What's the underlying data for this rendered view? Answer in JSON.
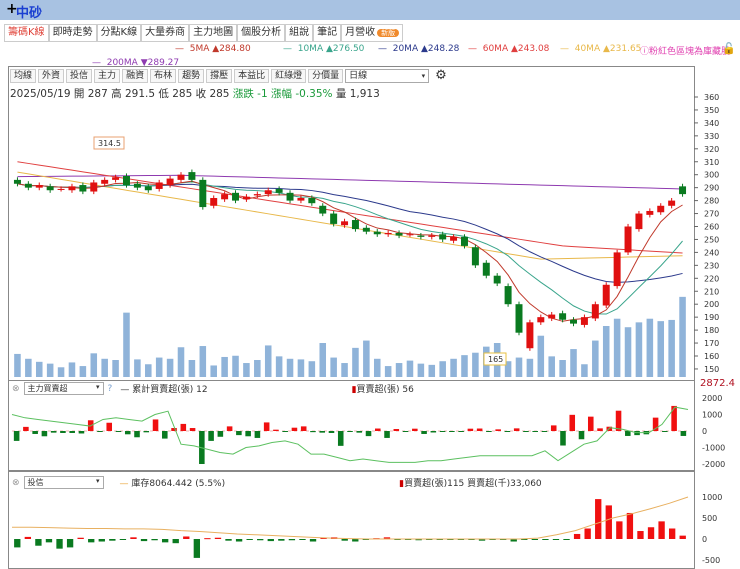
{
  "header": {
    "plus": "+",
    "stock_name": "中砂"
  },
  "tabs": [
    {
      "label": "籌碼K線",
      "active": true
    },
    {
      "label": "即時走勢"
    },
    {
      "label": "分點K線"
    },
    {
      "label": "大量券商"
    },
    {
      "label": "主力地圖"
    },
    {
      "label": "個股分析"
    },
    {
      "label": "組說"
    },
    {
      "label": "筆記"
    },
    {
      "label": "月營收",
      "badge": "新版"
    }
  ],
  "ma_legend": [
    {
      "label": "5MA",
      "arrow": "▲",
      "value": "284.80",
      "color": "#c0392b"
    },
    {
      "label": "10MA",
      "arrow": "▲",
      "value": "276.50",
      "color": "#3aa58c"
    },
    {
      "label": "20MA",
      "arrow": "▲",
      "value": "248.28",
      "color": "#2c3a8c"
    },
    {
      "label": "60MA",
      "arrow": "▲",
      "value": "243.08",
      "color": "#e04040"
    },
    {
      "label": "40MA",
      "arrow": "▲",
      "value": "231.65",
      "color": "#e8b84a"
    },
    {
      "label": "200MA",
      "arrow": "▼",
      "value": "289.27",
      "color": "#8e3ab0"
    }
  ],
  "hint": "ⓘ粉紅色區塊為庫藏股",
  "toolbar": [
    "均線",
    "外資",
    "投信",
    "主力",
    "融資",
    "布林",
    "趨勢",
    "撐壓",
    "本益比",
    "紅綠燈",
    "分價量"
  ],
  "period_select": "日線",
  "info": {
    "date": "2025/05/19",
    "open_label": "開",
    "open": "287",
    "high_label": "高",
    "high": "291.5",
    "low_label": "低",
    "low": "285",
    "close_label": "收",
    "close": "285",
    "chg_label": "漲跌",
    "chg": "-1",
    "pct_label": "漲幅",
    "pct": "-0.35%",
    "vol_label": "量",
    "vol": "1,913"
  },
  "chart_data": {
    "type": "candlestick",
    "y_ticks": [
      150,
      160,
      170,
      180,
      190,
      200,
      210,
      220,
      230,
      240,
      250,
      260,
      270,
      280,
      290,
      300,
      310,
      320,
      330,
      340,
      350,
      360
    ],
    "ylim": [
      145,
      362
    ],
    "annotations": {
      "high": "314.5",
      "low": "165"
    },
    "open": [
      296,
      293,
      290,
      291,
      289,
      288,
      292,
      287,
      293,
      296,
      299,
      293,
      291,
      289,
      292,
      296,
      302,
      296,
      276,
      281,
      286,
      281,
      284,
      285,
      289,
      286,
      280,
      282,
      276,
      270,
      261,
      265,
      259,
      256,
      254,
      255,
      254,
      253,
      252,
      254,
      249,
      252,
      244,
      232,
      222,
      214,
      200,
      166,
      186,
      189,
      193,
      188,
      184,
      189,
      199,
      214,
      240,
      258,
      269,
      271,
      276,
      291
    ],
    "close": [
      293,
      290,
      292,
      288,
      289,
      291,
      287,
      294,
      296,
      298,
      292,
      290,
      288,
      294,
      297,
      300,
      296,
      275,
      282,
      285,
      280,
      283,
      285,
      288,
      286,
      280,
      282,
      278,
      270,
      262,
      264,
      258,
      256,
      254,
      255,
      253,
      254,
      252,
      253,
      250,
      252,
      245,
      230,
      222,
      216,
      200,
      178,
      186,
      190,
      192,
      188,
      185,
      190,
      200,
      215,
      240,
      260,
      270,
      272,
      276,
      280,
      285
    ],
    "volume": [
      380,
      300,
      250,
      220,
      160,
      240,
      180,
      390,
      300,
      280,
      1060,
      290,
      210,
      320,
      300,
      490,
      280,
      510,
      190,
      330,
      350,
      230,
      280,
      520,
      340,
      300,
      290,
      260,
      560,
      320,
      230,
      480,
      600,
      300,
      180,
      230,
      270,
      220,
      200,
      260,
      300,
      360,
      400,
      500,
      560,
      260,
      320,
      300,
      680,
      340,
      280,
      460,
      210,
      600,
      840,
      960,
      820,
      900,
      960,
      920,
      940,
      1320,
      780,
      520
    ],
    "sub1": {
      "title_select": "主力買賣超",
      "line_label": "累計買賣超(張)",
      "line_value": "12",
      "bar_label": "買賣超(張)",
      "bar_value": "56",
      "axis_top": "2872.4",
      "y_ticks": [
        2000,
        1000,
        0,
        -1000,
        -2000
      ],
      "bars": [
        -600,
        250,
        -180,
        -320,
        -100,
        -120,
        -120,
        -150,
        650,
        -60,
        500,
        -60,
        -200,
        -380,
        -80,
        700,
        -460,
        180,
        430,
        180,
        -2000,
        -600,
        -350,
        280,
        -250,
        -320,
        -420,
        520,
        80,
        -40,
        200,
        280,
        -70,
        -100,
        -120,
        -900,
        -30,
        -100,
        -310,
        150,
        -420,
        120,
        -30,
        140,
        -180,
        -90,
        -50,
        -20,
        -30,
        140,
        150,
        -20,
        100,
        -30,
        160,
        -30,
        -60,
        -20,
        340,
        -880,
        980,
        -500,
        870,
        160,
        260,
        1230,
        -300,
        -250,
        -200,
        810,
        -60,
        1520,
        -300
      ],
      "line": [
        1000,
        800,
        700,
        600,
        500,
        400,
        300,
        700,
        800,
        700,
        600,
        1000,
        1200,
        -800,
        -900,
        -1100,
        -1300,
        -1400,
        -1000,
        -900,
        -700,
        -600,
        -800,
        -1400,
        -1400,
        -1600,
        -1800,
        -1700,
        -1800,
        -1900,
        -1900,
        -1900,
        -1800,
        -1800,
        -1700,
        -1600,
        -1500,
        -1500,
        -1500,
        -1500,
        -1500,
        -1200,
        -1800,
        -1300,
        -800,
        -600,
        200,
        100,
        -100,
        -100,
        400,
        1450,
        1300
      ]
    },
    "sub2": {
      "title_select": "投信",
      "line_label": "庫存8064.442 (5.5%)",
      "bar_label": "買賣超(張)115 買賣超(千)33,060",
      "y_ticks": [
        1000,
        500,
        0,
        -500
      ],
      "bars": [
        -200,
        50,
        -160,
        -80,
        -230,
        -200,
        30,
        -80,
        -60,
        -40,
        -20,
        40,
        -50,
        -30,
        -80,
        -100,
        60,
        -450,
        20,
        30,
        -40,
        -60,
        -20,
        -30,
        -50,
        -40,
        -30,
        -20,
        -60,
        30,
        40,
        -40,
        -60,
        -20,
        20,
        40,
        -20,
        -10,
        -30,
        -20,
        -10,
        -20,
        -10,
        -20,
        -40,
        -20,
        -10,
        -60,
        -20,
        -10,
        -20,
        -10,
        -10,
        120,
        250,
        950,
        800,
        420,
        620,
        190,
        280,
        420,
        250,
        80
      ],
      "line": [
        280,
        280,
        270,
        260,
        250,
        250,
        240,
        240,
        230,
        200,
        180,
        150,
        120,
        100,
        80,
        60,
        40,
        20,
        10,
        0,
        0,
        0,
        0,
        0,
        0,
        0,
        0,
        0,
        20,
        100,
        200,
        350,
        500,
        600,
        720,
        850,
        1000
      ]
    }
  }
}
